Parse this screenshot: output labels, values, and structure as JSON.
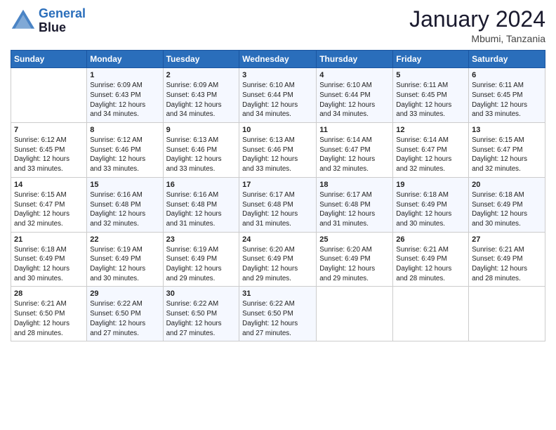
{
  "logo": {
    "line1": "General",
    "line2": "Blue"
  },
  "title": "January 2024",
  "subtitle": "Mbumi, Tanzania",
  "days_header": [
    "Sunday",
    "Monday",
    "Tuesday",
    "Wednesday",
    "Thursday",
    "Friday",
    "Saturday"
  ],
  "weeks": [
    [
      {
        "num": "",
        "info": ""
      },
      {
        "num": "1",
        "info": "Sunrise: 6:09 AM\nSunset: 6:43 PM\nDaylight: 12 hours\nand 34 minutes."
      },
      {
        "num": "2",
        "info": "Sunrise: 6:09 AM\nSunset: 6:43 PM\nDaylight: 12 hours\nand 34 minutes."
      },
      {
        "num": "3",
        "info": "Sunrise: 6:10 AM\nSunset: 6:44 PM\nDaylight: 12 hours\nand 34 minutes."
      },
      {
        "num": "4",
        "info": "Sunrise: 6:10 AM\nSunset: 6:44 PM\nDaylight: 12 hours\nand 34 minutes."
      },
      {
        "num": "5",
        "info": "Sunrise: 6:11 AM\nSunset: 6:45 PM\nDaylight: 12 hours\nand 33 minutes."
      },
      {
        "num": "6",
        "info": "Sunrise: 6:11 AM\nSunset: 6:45 PM\nDaylight: 12 hours\nand 33 minutes."
      }
    ],
    [
      {
        "num": "7",
        "info": "Sunrise: 6:12 AM\nSunset: 6:45 PM\nDaylight: 12 hours\nand 33 minutes."
      },
      {
        "num": "8",
        "info": "Sunrise: 6:12 AM\nSunset: 6:46 PM\nDaylight: 12 hours\nand 33 minutes."
      },
      {
        "num": "9",
        "info": "Sunrise: 6:13 AM\nSunset: 6:46 PM\nDaylight: 12 hours\nand 33 minutes."
      },
      {
        "num": "10",
        "info": "Sunrise: 6:13 AM\nSunset: 6:46 PM\nDaylight: 12 hours\nand 33 minutes."
      },
      {
        "num": "11",
        "info": "Sunrise: 6:14 AM\nSunset: 6:47 PM\nDaylight: 12 hours\nand 32 minutes."
      },
      {
        "num": "12",
        "info": "Sunrise: 6:14 AM\nSunset: 6:47 PM\nDaylight: 12 hours\nand 32 minutes."
      },
      {
        "num": "13",
        "info": "Sunrise: 6:15 AM\nSunset: 6:47 PM\nDaylight: 12 hours\nand 32 minutes."
      }
    ],
    [
      {
        "num": "14",
        "info": "Sunrise: 6:15 AM\nSunset: 6:47 PM\nDaylight: 12 hours\nand 32 minutes."
      },
      {
        "num": "15",
        "info": "Sunrise: 6:16 AM\nSunset: 6:48 PM\nDaylight: 12 hours\nand 32 minutes."
      },
      {
        "num": "16",
        "info": "Sunrise: 6:16 AM\nSunset: 6:48 PM\nDaylight: 12 hours\nand 31 minutes."
      },
      {
        "num": "17",
        "info": "Sunrise: 6:17 AM\nSunset: 6:48 PM\nDaylight: 12 hours\nand 31 minutes."
      },
      {
        "num": "18",
        "info": "Sunrise: 6:17 AM\nSunset: 6:48 PM\nDaylight: 12 hours\nand 31 minutes."
      },
      {
        "num": "19",
        "info": "Sunrise: 6:18 AM\nSunset: 6:49 PM\nDaylight: 12 hours\nand 30 minutes."
      },
      {
        "num": "20",
        "info": "Sunrise: 6:18 AM\nSunset: 6:49 PM\nDaylight: 12 hours\nand 30 minutes."
      }
    ],
    [
      {
        "num": "21",
        "info": "Sunrise: 6:18 AM\nSunset: 6:49 PM\nDaylight: 12 hours\nand 30 minutes."
      },
      {
        "num": "22",
        "info": "Sunrise: 6:19 AM\nSunset: 6:49 PM\nDaylight: 12 hours\nand 30 minutes."
      },
      {
        "num": "23",
        "info": "Sunrise: 6:19 AM\nSunset: 6:49 PM\nDaylight: 12 hours\nand 29 minutes."
      },
      {
        "num": "24",
        "info": "Sunrise: 6:20 AM\nSunset: 6:49 PM\nDaylight: 12 hours\nand 29 minutes."
      },
      {
        "num": "25",
        "info": "Sunrise: 6:20 AM\nSunset: 6:49 PM\nDaylight: 12 hours\nand 29 minutes."
      },
      {
        "num": "26",
        "info": "Sunrise: 6:21 AM\nSunset: 6:49 PM\nDaylight: 12 hours\nand 28 minutes."
      },
      {
        "num": "27",
        "info": "Sunrise: 6:21 AM\nSunset: 6:49 PM\nDaylight: 12 hours\nand 28 minutes."
      }
    ],
    [
      {
        "num": "28",
        "info": "Sunrise: 6:21 AM\nSunset: 6:50 PM\nDaylight: 12 hours\nand 28 minutes."
      },
      {
        "num": "29",
        "info": "Sunrise: 6:22 AM\nSunset: 6:50 PM\nDaylight: 12 hours\nand 27 minutes."
      },
      {
        "num": "30",
        "info": "Sunrise: 6:22 AM\nSunset: 6:50 PM\nDaylight: 12 hours\nand 27 minutes."
      },
      {
        "num": "31",
        "info": "Sunrise: 6:22 AM\nSunset: 6:50 PM\nDaylight: 12 hours\nand 27 minutes."
      },
      {
        "num": "",
        "info": ""
      },
      {
        "num": "",
        "info": ""
      },
      {
        "num": "",
        "info": ""
      }
    ]
  ]
}
